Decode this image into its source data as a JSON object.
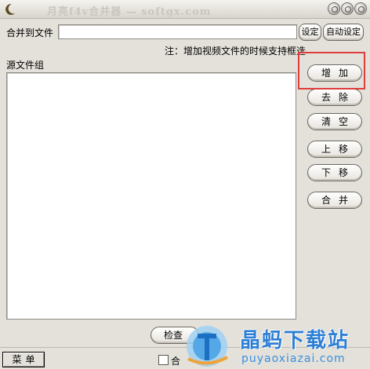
{
  "window": {
    "title": "月亮f4v合并器 — softgx.com"
  },
  "form": {
    "merge_to_file_label": "合并到文件",
    "output_path_value": "",
    "set_button": "设定",
    "auto_set_button": "自动设定",
    "note_text": "注：增加视频文件的时候支持框选",
    "source_group_label": "源文件组"
  },
  "side_buttons": {
    "add": "增加",
    "remove": "去除",
    "clear": "清空",
    "move_up": "上移",
    "move_down": "下移",
    "merge": "合并"
  },
  "bottom": {
    "check_button": "检查",
    "menu_button": "菜单",
    "checkbox_label": "合"
  },
  "watermark": {
    "brand": "晶蚂下载站",
    "url": "puyaoxiazai.com"
  },
  "colors": {
    "highlight_box": "#e03c3c",
    "watermark_blue": "#2e7fd4"
  }
}
